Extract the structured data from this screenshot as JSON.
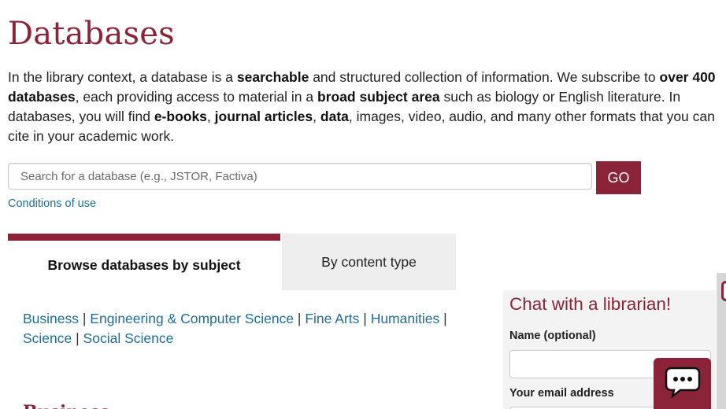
{
  "page": {
    "title": "Databases"
  },
  "intro": {
    "p1": "In the library context, a database is a ",
    "b1": "searchable",
    "p2": " and structured collection of information. We subscribe to ",
    "b2": "over 400 databases",
    "p3": ", each providing access to material in a ",
    "b3": "broad subject area",
    "p4": " such as biology or English literature. In databases, you will find ",
    "b4": "e-books",
    "p5": ", ",
    "b5": "journal articles",
    "p6": ", ",
    "b6": "data",
    "p7": ", images, video, audio, and many other formats that you can cite in your academic work."
  },
  "search": {
    "placeholder": "Search for a database (e.g., JSTOR, Factiva)",
    "value": "",
    "go_label": "GO",
    "conditions_label": "Conditions of use"
  },
  "tabs": [
    {
      "label": "Browse databases by subject",
      "active": true
    },
    {
      "label": "By content type",
      "active": false
    }
  ],
  "subjects": [
    "Business",
    "Engineering & Computer Science",
    "Fine Arts",
    "Humanities",
    "Science",
    "Social Science"
  ],
  "subject_separator": " | ",
  "next_section_heading": "Business",
  "chat": {
    "title": "Chat with a librarian!",
    "name_label": "Name (optional)",
    "name_value": "",
    "email_label": "Your email address",
    "email_value": ""
  },
  "colors": {
    "brand": "#8b2339",
    "link": "#1f6d97",
    "tab_inactive_bg": "#eeeeee",
    "chat_bg": "#f3f3f3"
  },
  "icons": {
    "chat_launcher": "chat-bubble-icon"
  }
}
